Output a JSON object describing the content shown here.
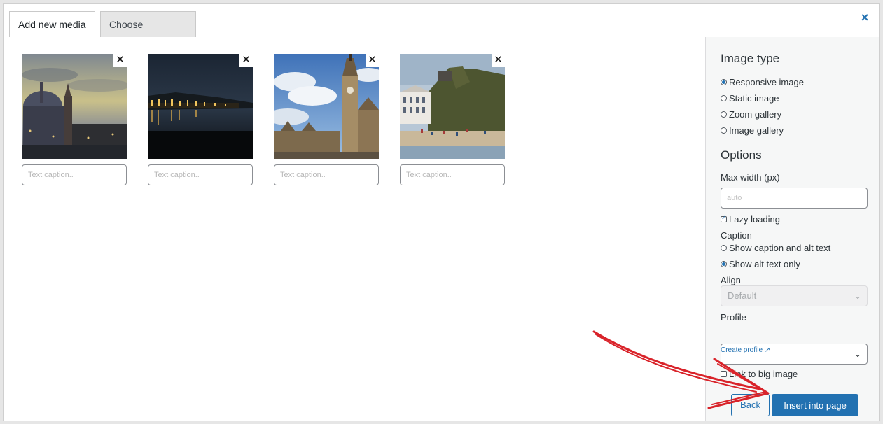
{
  "tabs": [
    {
      "label": "Add new media"
    },
    {
      "label": "Choose shortcode"
    }
  ],
  "close_icon": "×",
  "media": {
    "remove_glyph": "✕",
    "caption_placeholder": "Text caption..",
    "items": [
      {
        "scene": "cathedral-dusk"
      },
      {
        "scene": "harbour-night"
      },
      {
        "scene": "belfry-square"
      },
      {
        "scene": "seaside-cliff"
      }
    ]
  },
  "sidebar": {
    "image_type_heading": "Image type",
    "image_types": [
      {
        "label": "Responsive image",
        "selected": true
      },
      {
        "label": "Static image",
        "selected": false
      },
      {
        "label": "Zoom gallery",
        "selected": false
      },
      {
        "label": "Image gallery",
        "selected": false
      }
    ],
    "options_heading": "Options",
    "max_width_label": "Max width (px)",
    "max_width_placeholder": "auto",
    "lazy_loading_label": "Lazy loading",
    "lazy_loading_checked": true,
    "caption_label": "Caption",
    "caption_options": [
      {
        "label": "Show caption and alt text",
        "selected": false
      },
      {
        "label": "Show alt text only",
        "selected": true
      }
    ],
    "align_label": "Align",
    "align_value": "Default",
    "profile_label": "Profile",
    "profile_value": "",
    "create_profile_link": "Create profile ↗",
    "link_big_image_label": "Link to big image",
    "link_big_image_checked": false,
    "back_button": "Back",
    "insert_button": "Insert into page"
  },
  "colors": {
    "accent": "#2271b1",
    "annotation_arrow": "#d9232a"
  }
}
